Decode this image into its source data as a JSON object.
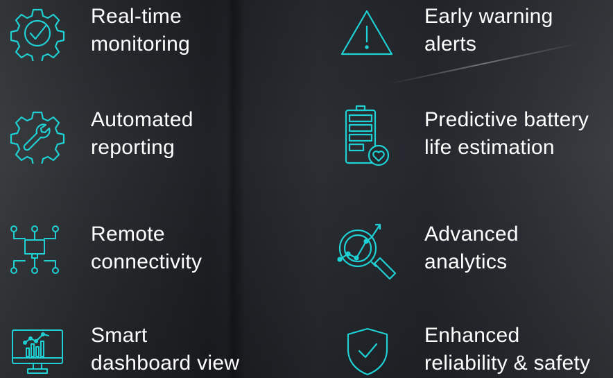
{
  "accent_color": "#1fd0d4",
  "features": [
    {
      "icon": "gear-check-icon",
      "line1": "Real-time",
      "line2": "monitoring"
    },
    {
      "icon": "warning-triangle-icon",
      "line1": "Early warning",
      "line2": "alerts"
    },
    {
      "icon": "gear-wrench-icon",
      "line1": "Automated",
      "line2": "reporting"
    },
    {
      "icon": "battery-heart-icon",
      "line1": "Predictive battery",
      "line2": "life estimation"
    },
    {
      "icon": "network-monitor-icon",
      "line1": "Remote",
      "line2": "connectivity"
    },
    {
      "icon": "analytics-magnifier-icon",
      "line1": "Advanced",
      "line2": "analytics"
    },
    {
      "icon": "dashboard-monitor-icon",
      "line1": "Smart",
      "line2": "dashboard view"
    },
    {
      "icon": "shield-check-icon",
      "line1": "Enhanced",
      "line2": "reliability & safety"
    }
  ]
}
